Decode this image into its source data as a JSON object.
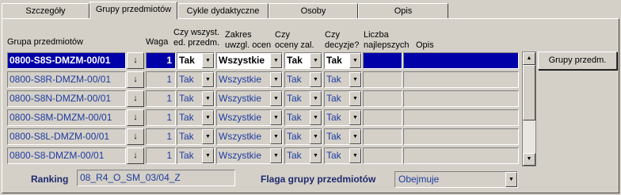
{
  "tabs": [
    {
      "label": "Szczegóły",
      "active": false
    },
    {
      "label": "Grupy przedmiotów",
      "active": true
    },
    {
      "label": "Cykle dydaktyczne",
      "active": false
    },
    {
      "label": "Osoby",
      "active": false
    },
    {
      "label": "Opis",
      "active": false
    }
  ],
  "headers": {
    "group": "Grupa przedmiotów",
    "weight": "Waga",
    "all_ed_1": "Czy wszyst.",
    "all_ed_2": "ed. przedm.",
    "range_1": "Zakres",
    "range_2": "uwzgl. ocen",
    "grades_1": "Czy",
    "grades_2": "oceny zal.",
    "decision_1": "Czy",
    "decision_2": "decyzje?",
    "best_1": "Liczba",
    "best_2": "najlepszych",
    "desc": "Opis"
  },
  "rows": [
    {
      "code": "0800-S8S-DMZM-00/01",
      "weight": "1",
      "all_ed": "Tak",
      "range": "Wszystkie",
      "grades": "Tak",
      "decision": "Tak",
      "best": "",
      "desc": "",
      "selected": true
    },
    {
      "code": "0800-S8R-DMZM-00/01",
      "weight": "1",
      "all_ed": "Tak",
      "range": "Wszystkie",
      "grades": "Tak",
      "decision": "Tak",
      "best": "",
      "desc": "",
      "selected": false
    },
    {
      "code": "0800-S8N-DMZM-00/01",
      "weight": "1",
      "all_ed": "Tak",
      "range": "Wszystkie",
      "grades": "Tak",
      "decision": "Tak",
      "best": "",
      "desc": "",
      "selected": false
    },
    {
      "code": "0800-S8M-DMZM-00/01",
      "weight": "1",
      "all_ed": "Tak",
      "range": "Wszystkie",
      "grades": "Tak",
      "decision": "Tak",
      "best": "",
      "desc": "",
      "selected": false
    },
    {
      "code": "0800-S8L-DMZM-00/01",
      "weight": "1",
      "all_ed": "Tak",
      "range": "Wszystkie",
      "grades": "Tak",
      "decision": "Tak",
      "best": "",
      "desc": "",
      "selected": false
    },
    {
      "code": "0800-S8-DMZM-00/01",
      "weight": "1",
      "all_ed": "Tak",
      "range": "Wszystkie",
      "grades": "Tak",
      "decision": "Tak",
      "best": "",
      "desc": "",
      "selected": false
    }
  ],
  "lookup_icon": "↓",
  "dropdown_icon": "▼",
  "side_button": "Grupy przedm.",
  "ranking": {
    "label": "Ranking",
    "value": "08_R4_O_SM_03/04_Z"
  },
  "flag": {
    "label": "Flaga grupy przedmiotów",
    "value": "Obejmuje"
  },
  "colors": {
    "selection": "#0000a8",
    "value_text": "#1e3ca0",
    "face": "#d4d0c8"
  }
}
